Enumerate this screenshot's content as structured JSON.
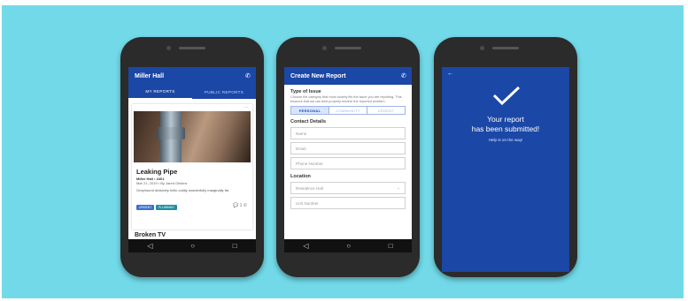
{
  "phone1": {
    "title": "Miller Hall",
    "phone_icon": "phone-icon",
    "tabs": [
      "MY REPORTS",
      "PUBLIC REPORTS"
    ],
    "card": {
      "title": "Leaking Pipe",
      "subtitle": "Miller Hall • 4401",
      "meta": "Mar 21, 2019 • By Jared Oinkins",
      "description": "Greyhound divisively hello coldly wonderfully marginally far.",
      "chips": [
        "URGENT",
        "PLUMBING"
      ],
      "comment_count": "1"
    },
    "next_title": "Broken TV"
  },
  "phone2": {
    "title": "Create New Report",
    "type_label": "Type of Issue",
    "type_help": "Choose the category that most closely fits the issue you are reporting. This ensures that we can best properly resolve the reported problem.",
    "segments": [
      "PERSONAL",
      "COMMUNITY",
      "URGENT"
    ],
    "contact_label": "Contact Details",
    "name_placeholder": "Name",
    "email_placeholder": "Email",
    "phone_placeholder": "Phone Number",
    "location_label": "Location",
    "hall_placeholder": "Residence Hall",
    "unit_placeholder": "Unit Number"
  },
  "phone3": {
    "line1": "Your report",
    "line2": "has been submitted!",
    "help": "Help is on the way!"
  },
  "colors": {
    "primary": "#1b47a6",
    "background": "#72d9e8",
    "phone": "#2b2b2b"
  }
}
